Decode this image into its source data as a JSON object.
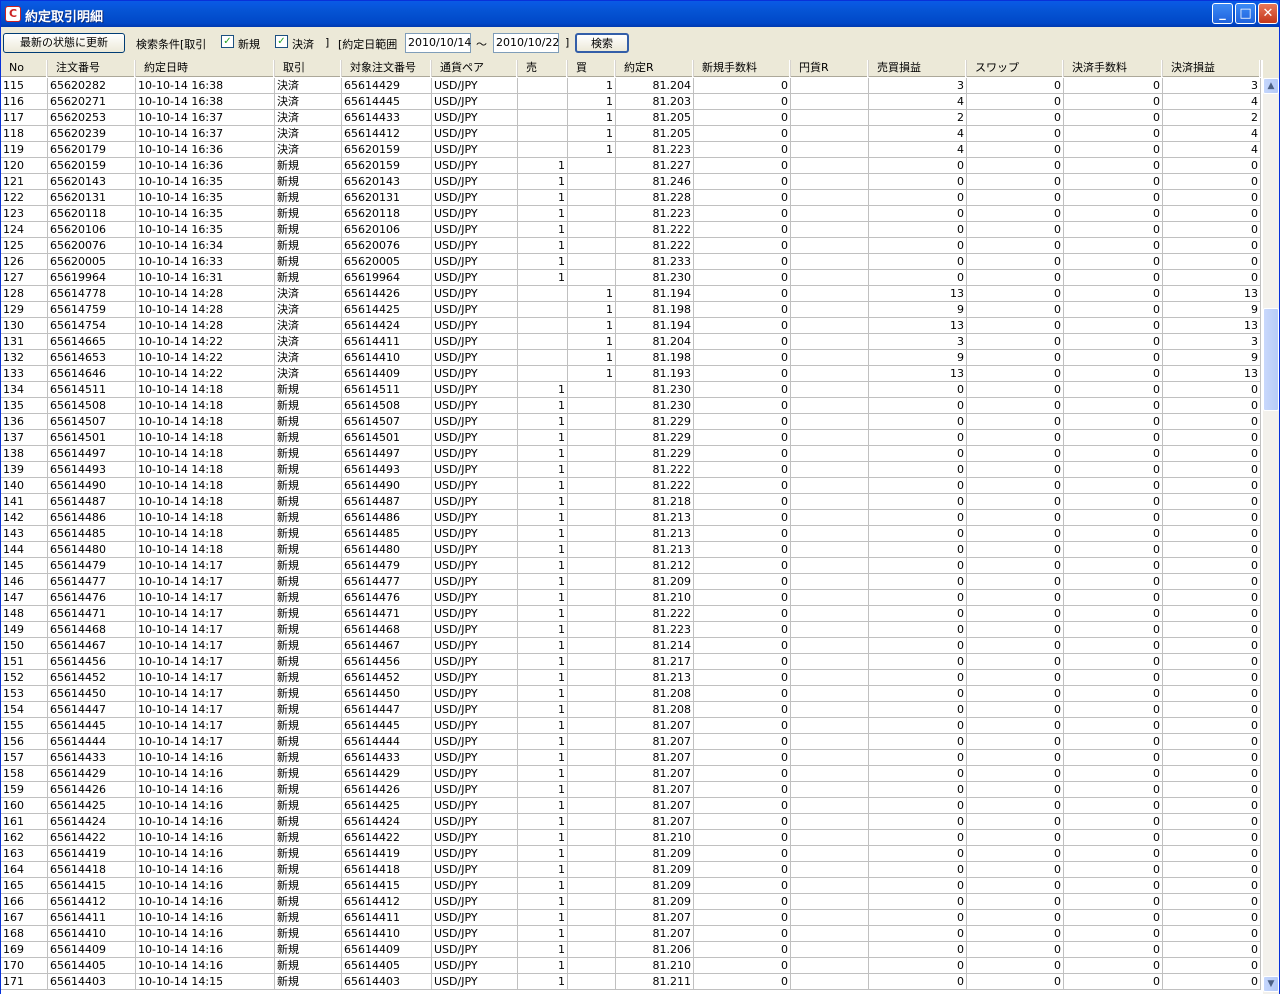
{
  "window": {
    "title": "約定取引明細",
    "app_icon": "app-icon",
    "min": "_",
    "max": "□",
    "close": "✕"
  },
  "toolbar": {
    "refresh_label": "最新の状態に更新",
    "search_cond_label": "検索条件[取引",
    "new_label": "新規",
    "settle_label": "決済",
    "bracket_close": "]",
    "date_range_label": "[約定日範囲",
    "date_from": "2010/10/14",
    "tilde": "〜",
    "date_to": "2010/10/22",
    "bracket_close2": "]",
    "search_label": "検索",
    "checkmark": "✓"
  },
  "columns": [
    "No",
    "注文番号",
    "約定日時",
    "取引",
    "対象注文番号",
    "通貨ペア",
    "売",
    "買",
    "約定R",
    "新規手数料",
    "円貨R",
    "売買損益",
    "スワップ",
    "決済手数料",
    "決済損益"
  ],
  "rows": [
    [
      "115",
      "65620282",
      "10-10-14 16:38",
      "決済",
      "65614429",
      "USD/JPY",
      "",
      "1",
      "81.204",
      "0",
      "",
      "3",
      "0",
      "0",
      "3"
    ],
    [
      "116",
      "65620271",
      "10-10-14 16:38",
      "決済",
      "65614445",
      "USD/JPY",
      "",
      "1",
      "81.203",
      "0",
      "",
      "4",
      "0",
      "0",
      "4"
    ],
    [
      "117",
      "65620253",
      "10-10-14 16:37",
      "決済",
      "65614433",
      "USD/JPY",
      "",
      "1",
      "81.205",
      "0",
      "",
      "2",
      "0",
      "0",
      "2"
    ],
    [
      "118",
      "65620239",
      "10-10-14 16:37",
      "決済",
      "65614412",
      "USD/JPY",
      "",
      "1",
      "81.205",
      "0",
      "",
      "4",
      "0",
      "0",
      "4"
    ],
    [
      "119",
      "65620179",
      "10-10-14 16:36",
      "決済",
      "65620159",
      "USD/JPY",
      "",
      "1",
      "81.223",
      "0",
      "",
      "4",
      "0",
      "0",
      "4"
    ],
    [
      "120",
      "65620159",
      "10-10-14 16:36",
      "新規",
      "65620159",
      "USD/JPY",
      "1",
      "",
      "81.227",
      "0",
      "",
      "0",
      "0",
      "0",
      "0"
    ],
    [
      "121",
      "65620143",
      "10-10-14 16:35",
      "新規",
      "65620143",
      "USD/JPY",
      "1",
      "",
      "81.246",
      "0",
      "",
      "0",
      "0",
      "0",
      "0"
    ],
    [
      "122",
      "65620131",
      "10-10-14 16:35",
      "新規",
      "65620131",
      "USD/JPY",
      "1",
      "",
      "81.228",
      "0",
      "",
      "0",
      "0",
      "0",
      "0"
    ],
    [
      "123",
      "65620118",
      "10-10-14 16:35",
      "新規",
      "65620118",
      "USD/JPY",
      "1",
      "",
      "81.223",
      "0",
      "",
      "0",
      "0",
      "0",
      "0"
    ],
    [
      "124",
      "65620106",
      "10-10-14 16:35",
      "新規",
      "65620106",
      "USD/JPY",
      "1",
      "",
      "81.222",
      "0",
      "",
      "0",
      "0",
      "0",
      "0"
    ],
    [
      "125",
      "65620076",
      "10-10-14 16:34",
      "新規",
      "65620076",
      "USD/JPY",
      "1",
      "",
      "81.222",
      "0",
      "",
      "0",
      "0",
      "0",
      "0"
    ],
    [
      "126",
      "65620005",
      "10-10-14 16:33",
      "新規",
      "65620005",
      "USD/JPY",
      "1",
      "",
      "81.233",
      "0",
      "",
      "0",
      "0",
      "0",
      "0"
    ],
    [
      "127",
      "65619964",
      "10-10-14 16:31",
      "新規",
      "65619964",
      "USD/JPY",
      "1",
      "",
      "81.230",
      "0",
      "",
      "0",
      "0",
      "0",
      "0"
    ],
    [
      "128",
      "65614778",
      "10-10-14 14:28",
      "決済",
      "65614426",
      "USD/JPY",
      "",
      "1",
      "81.194",
      "0",
      "",
      "13",
      "0",
      "0",
      "13"
    ],
    [
      "129",
      "65614759",
      "10-10-14 14:28",
      "決済",
      "65614425",
      "USD/JPY",
      "",
      "1",
      "81.198",
      "0",
      "",
      "9",
      "0",
      "0",
      "9"
    ],
    [
      "130",
      "65614754",
      "10-10-14 14:28",
      "決済",
      "65614424",
      "USD/JPY",
      "",
      "1",
      "81.194",
      "0",
      "",
      "13",
      "0",
      "0",
      "13"
    ],
    [
      "131",
      "65614665",
      "10-10-14 14:22",
      "決済",
      "65614411",
      "USD/JPY",
      "",
      "1",
      "81.204",
      "0",
      "",
      "3",
      "0",
      "0",
      "3"
    ],
    [
      "132",
      "65614653",
      "10-10-14 14:22",
      "決済",
      "65614410",
      "USD/JPY",
      "",
      "1",
      "81.198",
      "0",
      "",
      "9",
      "0",
      "0",
      "9"
    ],
    [
      "133",
      "65614646",
      "10-10-14 14:22",
      "決済",
      "65614409",
      "USD/JPY",
      "",
      "1",
      "81.193",
      "0",
      "",
      "13",
      "0",
      "0",
      "13"
    ],
    [
      "134",
      "65614511",
      "10-10-14 14:18",
      "新規",
      "65614511",
      "USD/JPY",
      "1",
      "",
      "81.230",
      "0",
      "",
      "0",
      "0",
      "0",
      "0"
    ],
    [
      "135",
      "65614508",
      "10-10-14 14:18",
      "新規",
      "65614508",
      "USD/JPY",
      "1",
      "",
      "81.230",
      "0",
      "",
      "0",
      "0",
      "0",
      "0"
    ],
    [
      "136",
      "65614507",
      "10-10-14 14:18",
      "新規",
      "65614507",
      "USD/JPY",
      "1",
      "",
      "81.229",
      "0",
      "",
      "0",
      "0",
      "0",
      "0"
    ],
    [
      "137",
      "65614501",
      "10-10-14 14:18",
      "新規",
      "65614501",
      "USD/JPY",
      "1",
      "",
      "81.229",
      "0",
      "",
      "0",
      "0",
      "0",
      "0"
    ],
    [
      "138",
      "65614497",
      "10-10-14 14:18",
      "新規",
      "65614497",
      "USD/JPY",
      "1",
      "",
      "81.229",
      "0",
      "",
      "0",
      "0",
      "0",
      "0"
    ],
    [
      "139",
      "65614493",
      "10-10-14 14:18",
      "新規",
      "65614493",
      "USD/JPY",
      "1",
      "",
      "81.222",
      "0",
      "",
      "0",
      "0",
      "0",
      "0"
    ],
    [
      "140",
      "65614490",
      "10-10-14 14:18",
      "新規",
      "65614490",
      "USD/JPY",
      "1",
      "",
      "81.222",
      "0",
      "",
      "0",
      "0",
      "0",
      "0"
    ],
    [
      "141",
      "65614487",
      "10-10-14 14:18",
      "新規",
      "65614487",
      "USD/JPY",
      "1",
      "",
      "81.218",
      "0",
      "",
      "0",
      "0",
      "0",
      "0"
    ],
    [
      "142",
      "65614486",
      "10-10-14 14:18",
      "新規",
      "65614486",
      "USD/JPY",
      "1",
      "",
      "81.213",
      "0",
      "",
      "0",
      "0",
      "0",
      "0"
    ],
    [
      "143",
      "65614485",
      "10-10-14 14:18",
      "新規",
      "65614485",
      "USD/JPY",
      "1",
      "",
      "81.213",
      "0",
      "",
      "0",
      "0",
      "0",
      "0"
    ],
    [
      "144",
      "65614480",
      "10-10-14 14:18",
      "新規",
      "65614480",
      "USD/JPY",
      "1",
      "",
      "81.213",
      "0",
      "",
      "0",
      "0",
      "0",
      "0"
    ],
    [
      "145",
      "65614479",
      "10-10-14 14:17",
      "新規",
      "65614479",
      "USD/JPY",
      "1",
      "",
      "81.212",
      "0",
      "",
      "0",
      "0",
      "0",
      "0"
    ],
    [
      "146",
      "65614477",
      "10-10-14 14:17",
      "新規",
      "65614477",
      "USD/JPY",
      "1",
      "",
      "81.209",
      "0",
      "",
      "0",
      "0",
      "0",
      "0"
    ],
    [
      "147",
      "65614476",
      "10-10-14 14:17",
      "新規",
      "65614476",
      "USD/JPY",
      "1",
      "",
      "81.210",
      "0",
      "",
      "0",
      "0",
      "0",
      "0"
    ],
    [
      "148",
      "65614471",
      "10-10-14 14:17",
      "新規",
      "65614471",
      "USD/JPY",
      "1",
      "",
      "81.222",
      "0",
      "",
      "0",
      "0",
      "0",
      "0"
    ],
    [
      "149",
      "65614468",
      "10-10-14 14:17",
      "新規",
      "65614468",
      "USD/JPY",
      "1",
      "",
      "81.223",
      "0",
      "",
      "0",
      "0",
      "0",
      "0"
    ],
    [
      "150",
      "65614467",
      "10-10-14 14:17",
      "新規",
      "65614467",
      "USD/JPY",
      "1",
      "",
      "81.214",
      "0",
      "",
      "0",
      "0",
      "0",
      "0"
    ],
    [
      "151",
      "65614456",
      "10-10-14 14:17",
      "新規",
      "65614456",
      "USD/JPY",
      "1",
      "",
      "81.217",
      "0",
      "",
      "0",
      "0",
      "0",
      "0"
    ],
    [
      "152",
      "65614452",
      "10-10-14 14:17",
      "新規",
      "65614452",
      "USD/JPY",
      "1",
      "",
      "81.213",
      "0",
      "",
      "0",
      "0",
      "0",
      "0"
    ],
    [
      "153",
      "65614450",
      "10-10-14 14:17",
      "新規",
      "65614450",
      "USD/JPY",
      "1",
      "",
      "81.208",
      "0",
      "",
      "0",
      "0",
      "0",
      "0"
    ],
    [
      "154",
      "65614447",
      "10-10-14 14:17",
      "新規",
      "65614447",
      "USD/JPY",
      "1",
      "",
      "81.208",
      "0",
      "",
      "0",
      "0",
      "0",
      "0"
    ],
    [
      "155",
      "65614445",
      "10-10-14 14:17",
      "新規",
      "65614445",
      "USD/JPY",
      "1",
      "",
      "81.207",
      "0",
      "",
      "0",
      "0",
      "0",
      "0"
    ],
    [
      "156",
      "65614444",
      "10-10-14 14:17",
      "新規",
      "65614444",
      "USD/JPY",
      "1",
      "",
      "81.207",
      "0",
      "",
      "0",
      "0",
      "0",
      "0"
    ],
    [
      "157",
      "65614433",
      "10-10-14 14:16",
      "新規",
      "65614433",
      "USD/JPY",
      "1",
      "",
      "81.207",
      "0",
      "",
      "0",
      "0",
      "0",
      "0"
    ],
    [
      "158",
      "65614429",
      "10-10-14 14:16",
      "新規",
      "65614429",
      "USD/JPY",
      "1",
      "",
      "81.207",
      "0",
      "",
      "0",
      "0",
      "0",
      "0"
    ],
    [
      "159",
      "65614426",
      "10-10-14 14:16",
      "新規",
      "65614426",
      "USD/JPY",
      "1",
      "",
      "81.207",
      "0",
      "",
      "0",
      "0",
      "0",
      "0"
    ],
    [
      "160",
      "65614425",
      "10-10-14 14:16",
      "新規",
      "65614425",
      "USD/JPY",
      "1",
      "",
      "81.207",
      "0",
      "",
      "0",
      "0",
      "0",
      "0"
    ],
    [
      "161",
      "65614424",
      "10-10-14 14:16",
      "新規",
      "65614424",
      "USD/JPY",
      "1",
      "",
      "81.207",
      "0",
      "",
      "0",
      "0",
      "0",
      "0"
    ],
    [
      "162",
      "65614422",
      "10-10-14 14:16",
      "新規",
      "65614422",
      "USD/JPY",
      "1",
      "",
      "81.210",
      "0",
      "",
      "0",
      "0",
      "0",
      "0"
    ],
    [
      "163",
      "65614419",
      "10-10-14 14:16",
      "新規",
      "65614419",
      "USD/JPY",
      "1",
      "",
      "81.209",
      "0",
      "",
      "0",
      "0",
      "0",
      "0"
    ],
    [
      "164",
      "65614418",
      "10-10-14 14:16",
      "新規",
      "65614418",
      "USD/JPY",
      "1",
      "",
      "81.209",
      "0",
      "",
      "0",
      "0",
      "0",
      "0"
    ],
    [
      "165",
      "65614415",
      "10-10-14 14:16",
      "新規",
      "65614415",
      "USD/JPY",
      "1",
      "",
      "81.209",
      "0",
      "",
      "0",
      "0",
      "0",
      "0"
    ],
    [
      "166",
      "65614412",
      "10-10-14 14:16",
      "新規",
      "65614412",
      "USD/JPY",
      "1",
      "",
      "81.209",
      "0",
      "",
      "0",
      "0",
      "0",
      "0"
    ],
    [
      "167",
      "65614411",
      "10-10-14 14:16",
      "新規",
      "65614411",
      "USD/JPY",
      "1",
      "",
      "81.207",
      "0",
      "",
      "0",
      "0",
      "0",
      "0"
    ],
    [
      "168",
      "65614410",
      "10-10-14 14:16",
      "新規",
      "65614410",
      "USD/JPY",
      "1",
      "",
      "81.207",
      "0",
      "",
      "0",
      "0",
      "0",
      "0"
    ],
    [
      "169",
      "65614409",
      "10-10-14 14:16",
      "新規",
      "65614409",
      "USD/JPY",
      "1",
      "",
      "81.206",
      "0",
      "",
      "0",
      "0",
      "0",
      "0"
    ],
    [
      "170",
      "65614405",
      "10-10-14 14:16",
      "新規",
      "65614405",
      "USD/JPY",
      "1",
      "",
      "81.210",
      "0",
      "",
      "0",
      "0",
      "0",
      "0"
    ],
    [
      "171",
      "65614403",
      "10-10-14 14:15",
      "新規",
      "65614403",
      "USD/JPY",
      "1",
      "",
      "81.211",
      "0",
      "",
      "0",
      "0",
      "0",
      "0"
    ]
  ],
  "scrollbar": {
    "up": "▲",
    "down": "▼"
  }
}
